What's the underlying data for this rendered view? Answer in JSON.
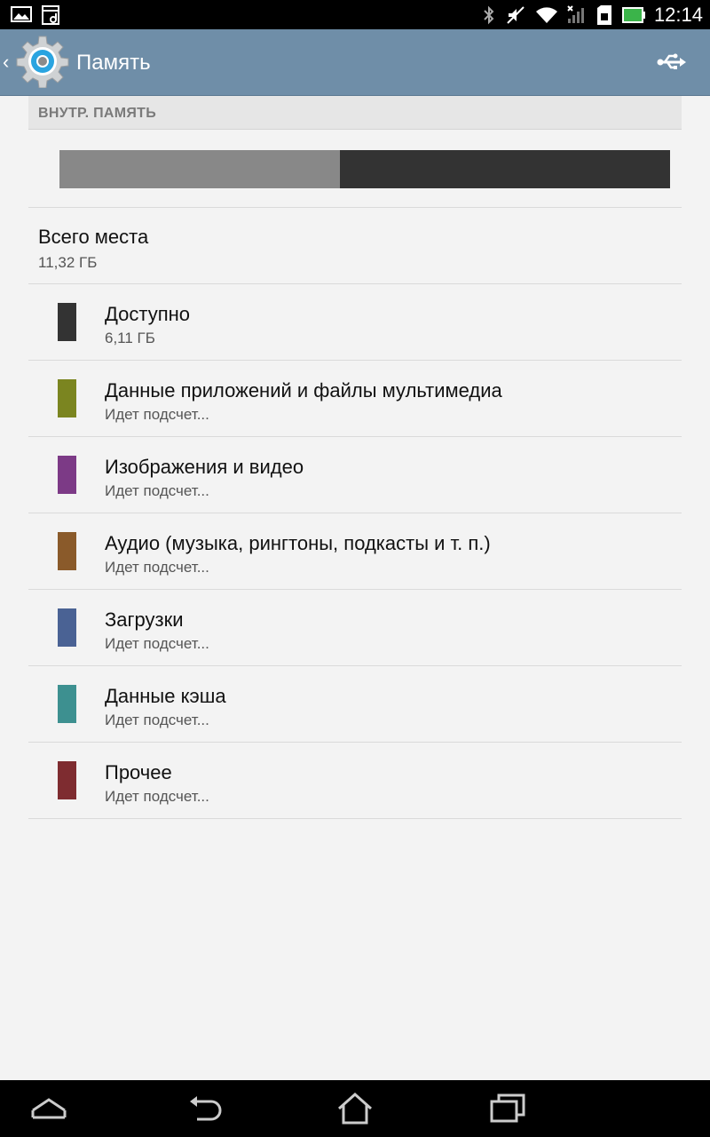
{
  "status_bar": {
    "time": "12:14",
    "icons": [
      "image-notification-icon",
      "media-notification-icon",
      "bluetooth-icon",
      "mute-icon",
      "wifi-icon",
      "no-signal-icon",
      "sd-card-icon",
      "battery-icon"
    ]
  },
  "action_bar": {
    "title": "Память",
    "app_icon": "settings-gear-icon",
    "action_icon": "usb-icon"
  },
  "storage": {
    "section_header": "ВНУТР. ПАМЯТЬ",
    "used_fraction": 0.46,
    "colors": {
      "used": "#888888",
      "free": "#333333"
    },
    "total": {
      "label": "Всего места",
      "value": "11,32 ГБ"
    },
    "items": [
      {
        "label": "Доступно",
        "value": "6,11 ГБ",
        "color": "#333333"
      },
      {
        "label": "Данные приложений и файлы мультимедиа",
        "value": "Идет подсчет...",
        "color": "#7b8520"
      },
      {
        "label": "Изображения и видео",
        "value": "Идет подсчет...",
        "color": "#7c3a86"
      },
      {
        "label": "Аудио (музыка, рингтоны, подкасты и т. п.)",
        "value": "Идет подсчет...",
        "color": "#8a5a2a"
      },
      {
        "label": "Загрузки",
        "value": "Идет подсчет...",
        "color": "#4a6294"
      },
      {
        "label": "Данные кэша",
        "value": "Идет подсчет...",
        "color": "#3d9090"
      },
      {
        "label": "Прочее",
        "value": "Идет подсчет...",
        "color": "#7e2c30"
      }
    ]
  },
  "nav_bar": {
    "buttons": [
      "collapse-icon",
      "back-icon",
      "home-icon",
      "recent-apps-icon"
    ]
  }
}
